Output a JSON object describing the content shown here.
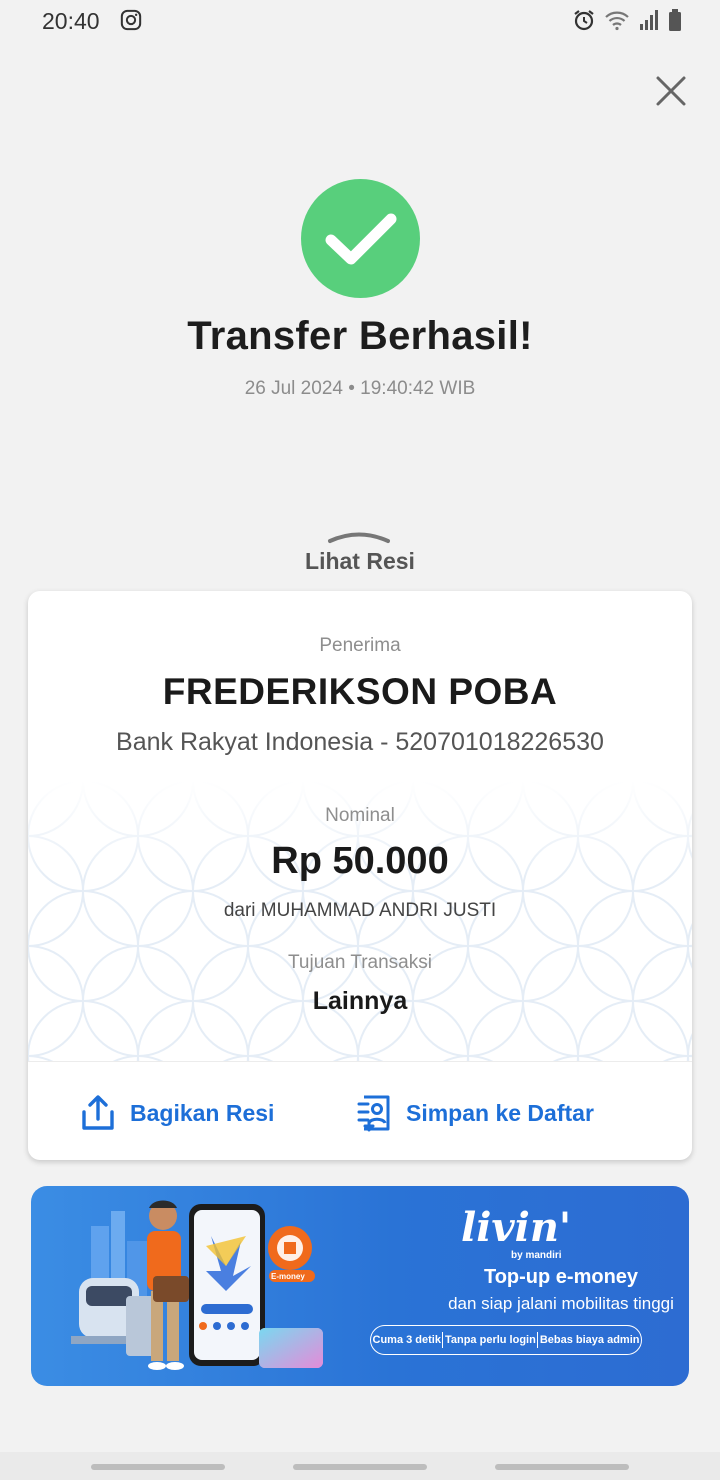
{
  "status_bar": {
    "time": "20:40",
    "icons": [
      "instagram-icon",
      "alarm-icon",
      "wifi-icon",
      "signal-icon",
      "battery-icon"
    ]
  },
  "header": {
    "close_icon": "close-icon"
  },
  "result": {
    "icon": "check-icon",
    "title": "Transfer Berhasil!",
    "datetime": "26 Jul 2024 • 19:40:42 WIB",
    "success_color": "#58cf7c"
  },
  "receipt": {
    "toggle_label": "Lihat Resi",
    "recipient_label": "Penerima",
    "recipient_name": "FREDERIKSON POBA",
    "bank_info": "Bank Rakyat Indonesia - 520701018226530",
    "amount_label": "Nominal",
    "amount": "Rp 50.000",
    "sender": "dari MUHAMMAD ANDRI JUSTI",
    "purpose_label": "Tujuan Transaksi",
    "purpose": "Lainnya",
    "actions": {
      "share_label": "Bagikan Resi",
      "share_icon": "share-icon",
      "save_label": "Simpan ke Daftar",
      "save_icon": "save-contact-icon"
    },
    "accent_color": "#1d6fd8"
  },
  "banner": {
    "brand": "livin'",
    "brand_sub": "by mandiri",
    "headline": "Top-up e-money",
    "subline": "dan siap jalani mobilitas tinggi",
    "features": [
      "Cuma 3 detik",
      "Tanpa perlu login",
      "Bebas biaya admin"
    ],
    "badge": "E-money"
  }
}
